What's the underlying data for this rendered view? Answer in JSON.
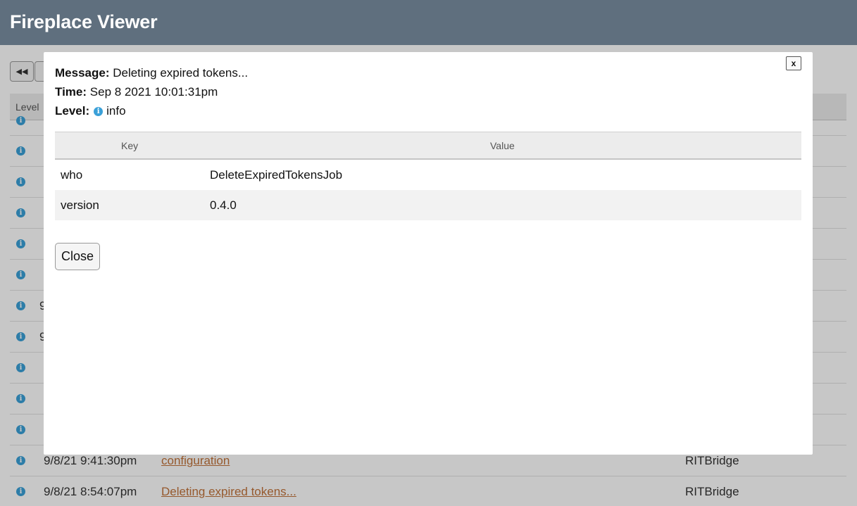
{
  "app": {
    "title": "Fireplace Viewer"
  },
  "table": {
    "level_header": "Level"
  },
  "rows": [
    {
      "time": "9/8/21 9:41:30pm",
      "message": "configuration",
      "source": "RITBridge"
    },
    {
      "time": "9/8/21 8:54:07pm",
      "message": "Deleting expired tokens...",
      "source": "RITBridge"
    }
  ],
  "partial_rows": [
    "9",
    "9"
  ],
  "icons": {
    "info": "i",
    "rewind": "◀◀"
  },
  "modal": {
    "close_x": "x",
    "message_label": "Message:",
    "message_value": "Deleting expired tokens...",
    "time_label": "Time:",
    "time_value": "Sep 8 2021 10:01:31pm",
    "level_label": "Level:",
    "level_value": "info",
    "key_header": "Key",
    "value_header": "Value",
    "entries": [
      {
        "key": "who",
        "value": "DeleteExpiredTokensJob"
      },
      {
        "key": "version",
        "value": "0.4.0"
      }
    ],
    "close_button": "Close"
  },
  "colors": {
    "header": "#5f6f7e",
    "info": "#3aa0d8",
    "link": "#c0723a"
  }
}
